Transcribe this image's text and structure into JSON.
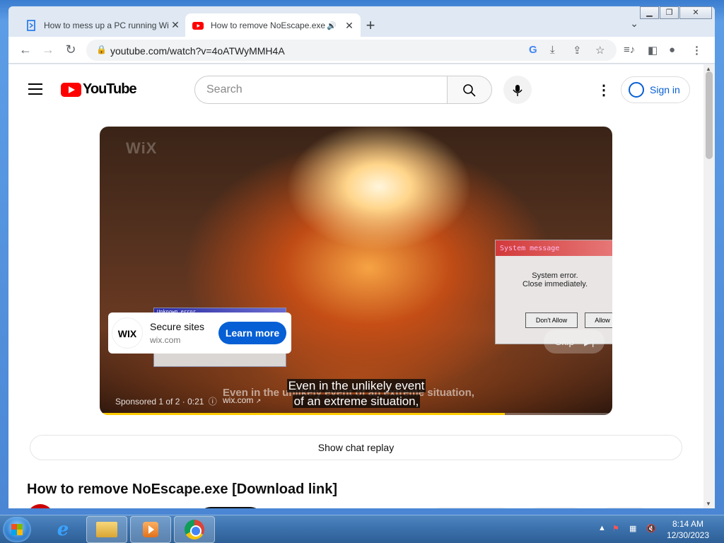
{
  "browser": {
    "tabs": [
      {
        "title": "How to mess up a PC running Wi",
        "active": false
      },
      {
        "title": "How to remove NoEscape.exe",
        "active": true
      }
    ],
    "new_tab": "+",
    "url": "youtube.com/watch?v=4oATWyMMH4A"
  },
  "youtube": {
    "logo_text": "YouTube",
    "search_placeholder": "Search",
    "sign_in": "Sign in",
    "ad": {
      "watermark": "WiX",
      "advertiser": "Secure sites",
      "domain": "wix.com",
      "logo": "WIX",
      "cta": "Learn more",
      "skip": "Skip",
      "sponsored": "Sponsored 1 of 2 · 0:21",
      "ad_url": "wix.com",
      "caption_bg": "Even in the unlikely event of an extreme situation,",
      "caption_line1": "Even in the unlikely event",
      "caption_line2": "of an extreme situation,",
      "progress": 0.79,
      "system_message": {
        "title": "System message",
        "line1": "System error.",
        "line2": "Close immediately.",
        "btn1": "Don't Allow",
        "btn2": "Allow"
      },
      "unknown_error_title": "Unknown error"
    },
    "chat_replay": "Show chat replay",
    "video_title": "How to remove NoEscape.exe [Download link]"
  },
  "taskbar": {
    "time": "8:14 AM",
    "date": "12/30/2023"
  },
  "colors": {
    "youtube_red": "#ff0000",
    "link_blue": "#065fd4",
    "progress_yellow": "#ffcc00"
  }
}
